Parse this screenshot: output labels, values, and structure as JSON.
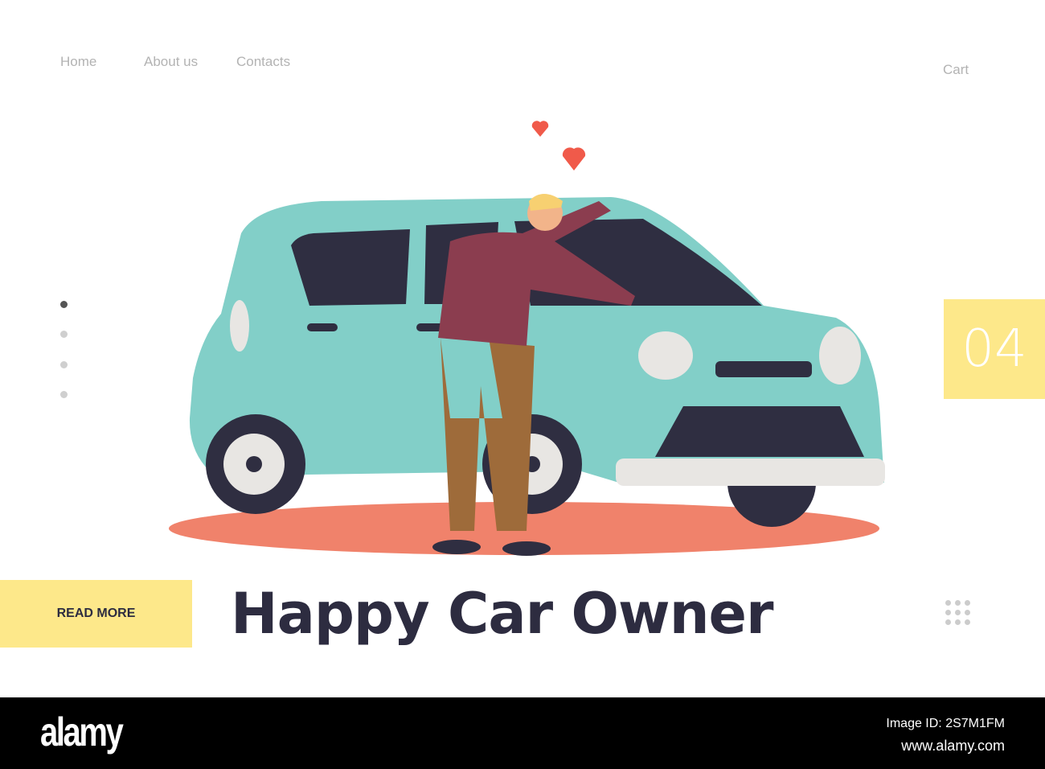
{
  "nav": {
    "items": [
      "Home",
      "About us",
      "Contacts"
    ],
    "cart": "Cart"
  },
  "slide_number": "04",
  "read_more": "READ MORE",
  "title": "Happy Car Owner",
  "footer": {
    "logo": "alamy",
    "image_id": "Image ID: 2S7M1FM",
    "url": "www.alamy.com"
  },
  "colors": {
    "car": "#82cfc8",
    "window": "#2f2e41",
    "floor": "#f0826b",
    "accent": "#fde88a",
    "heart": "#f05a4a"
  }
}
